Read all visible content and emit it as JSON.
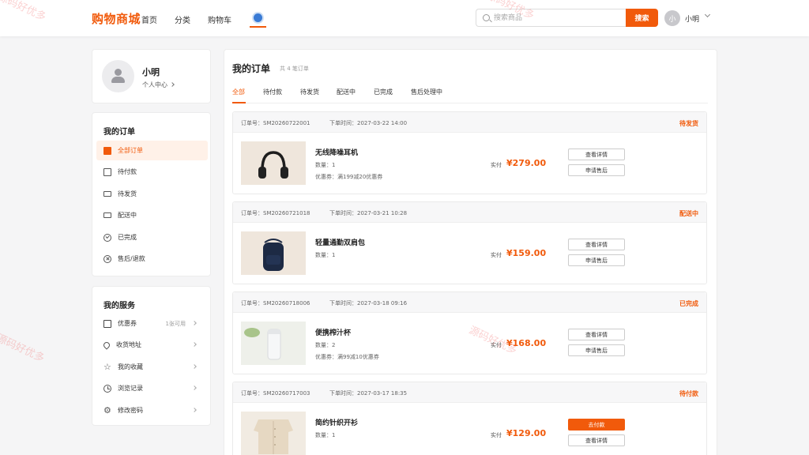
{
  "header": {
    "logo": "购物商城",
    "nav": [
      "首页",
      "分类",
      "购物车"
    ],
    "search_placeholder": "搜索商品",
    "search_button": "搜索",
    "user_initial": "小",
    "user_name": "小明"
  },
  "profile": {
    "name": "小明",
    "link": "个人中心"
  },
  "orders_menu": {
    "title": "我的订单",
    "items": [
      {
        "label": "全部订单",
        "icon": "ticket-icon",
        "active": true
      },
      {
        "label": "待付款",
        "icon": "wallet-icon"
      },
      {
        "label": "待发货",
        "icon": "truck-icon"
      },
      {
        "label": "配送中",
        "icon": "truck-icon"
      },
      {
        "label": "已完成",
        "icon": "check-circle-icon"
      },
      {
        "label": "售后/退款",
        "icon": "x-circle-icon"
      }
    ]
  },
  "services_menu": {
    "title": "我的服务",
    "items": [
      {
        "label": "优惠券",
        "icon": "ticket-icon",
        "extra": "1张可用"
      },
      {
        "label": "收货地址",
        "icon": "location-pin-icon"
      },
      {
        "label": "我的收藏",
        "icon": "star-icon"
      },
      {
        "label": "浏览记录",
        "icon": "clock-icon"
      },
      {
        "label": "修改密码",
        "icon": "gear-icon"
      }
    ]
  },
  "main": {
    "title": "我的订单",
    "subtitle": "共 4 笔订单",
    "tabs": [
      "全部",
      "待付款",
      "待发货",
      "配送中",
      "已完成",
      "售后处理中"
    ],
    "active_tab": 0
  },
  "orders": [
    {
      "no": "订单号：SM20260722001",
      "time": "下单时间：2027-03-22 14:00",
      "status": "待发货",
      "name": "无线降噪耳机",
      "qty": "数量：1",
      "coupon": "优惠券：满199减20优惠券",
      "pay_label": "实付",
      "amount": "¥279.00",
      "buttons": [
        "查看详情",
        "申请售后"
      ],
      "primary_first": false
    },
    {
      "no": "订单号：SM20260721018",
      "time": "下单时间：2027-03-21 10:28",
      "status": "配送中",
      "name": "轻量通勤双肩包",
      "qty": "数量：1",
      "coupon": "",
      "pay_label": "实付",
      "amount": "¥159.00",
      "buttons": [
        "查看详情",
        "申请售后"
      ],
      "primary_first": false
    },
    {
      "no": "订单号：SM20260718006",
      "time": "下单时间：2027-03-18 09:16",
      "status": "已完成",
      "name": "便携榨汁杯",
      "qty": "数量：2",
      "coupon": "优惠券：满99减10优惠券",
      "pay_label": "实付",
      "amount": "¥168.00",
      "buttons": [
        "查看详情",
        "申请售后"
      ],
      "primary_first": false
    },
    {
      "no": "订单号：SM20260717003",
      "time": "下单时间：2027-03-17 18:35",
      "status": "待付款",
      "name": "简约针织开衫",
      "qty": "数量：1",
      "coupon": "",
      "pay_label": "实付",
      "amount": "¥129.00",
      "buttons": [
        "去付款",
        "查看详情"
      ],
      "primary_first": true
    }
  ],
  "watermark_text": "源码好优多",
  "colors": {
    "accent": "#f15a0b",
    "background": "#f5f5f6"
  }
}
